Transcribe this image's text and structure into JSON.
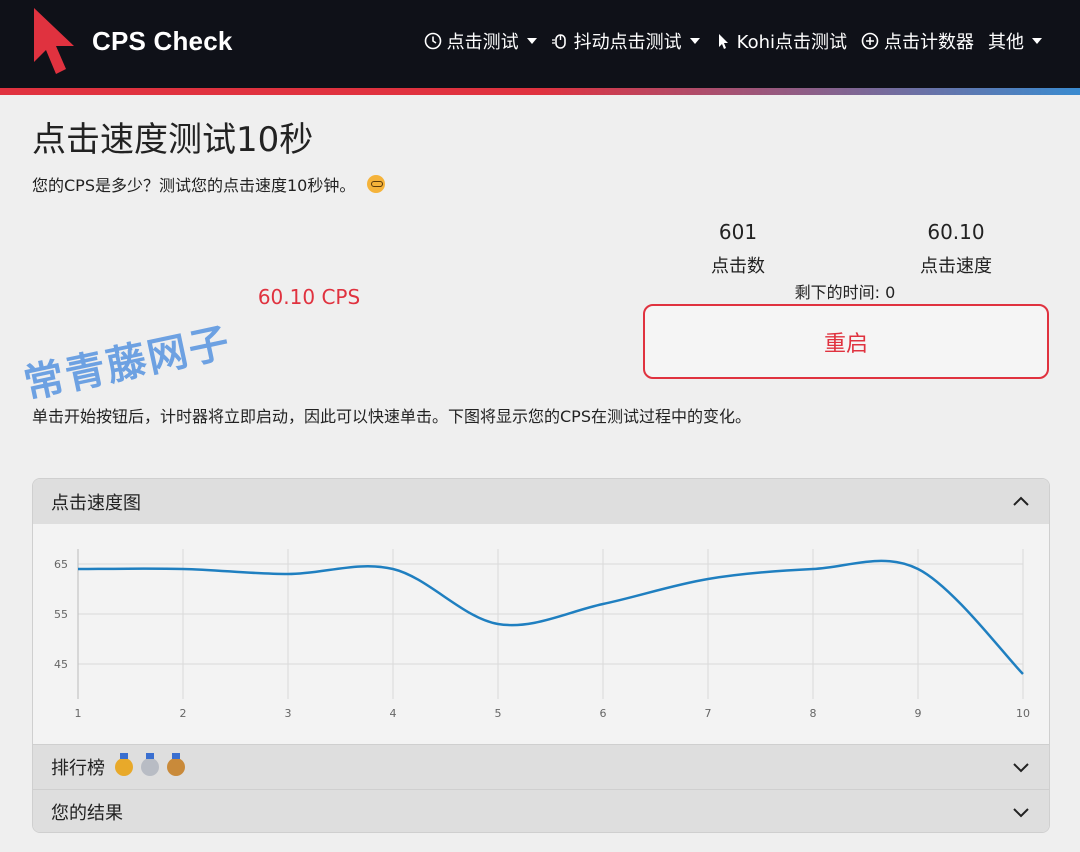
{
  "brand": {
    "name": "CPS Check"
  },
  "nav": {
    "items": [
      {
        "label": "点击测试",
        "icon": "clock-icon",
        "has_dropdown": true
      },
      {
        "label": "抖动点击测试",
        "icon": "mouse-icon",
        "has_dropdown": true
      },
      {
        "label": "Kohi点击测试",
        "icon": "cursor-icon",
        "has_dropdown": false
      },
      {
        "label": "点击计数器",
        "icon": "plus-circle-icon",
        "has_dropdown": false
      },
      {
        "label": "其他",
        "icon": "",
        "has_dropdown": true
      }
    ]
  },
  "page": {
    "title": "点击速度测试10秒",
    "subtitle": "您的CPS是多少？测试您的点击速度10秒钟。"
  },
  "test": {
    "cps_display": "60.10 CPS",
    "clicks_value": "601",
    "clicks_label": "点击数",
    "speed_value": "60.10",
    "speed_label": "点击速度",
    "remaining": "剩下的时间: 0",
    "restart_label": "重启"
  },
  "instruction": "单击开始按钮后，计时器将立即启动，因此可以快速单击。下图将显示您的CPS在测试过程中的变化。",
  "watermark": "常青藤网子",
  "accordion": {
    "chart_title": "点击速度图",
    "ranking_title": "排行榜",
    "results_title": "您的结果"
  },
  "colors": {
    "accent": "#e0323f",
    "line": "#1f7fc0",
    "navbar": "#0f1118"
  },
  "chart_data": {
    "type": "line",
    "x": [
      1,
      2,
      3,
      4,
      5,
      6,
      7,
      8,
      9,
      10
    ],
    "series": [
      {
        "values": [
          64,
          64,
          63,
          64,
          53,
          57,
          62,
          64,
          64,
          43
        ]
      }
    ],
    "xlabel": "",
    "ylabel": "",
    "yticks": [
      45,
      55,
      65
    ],
    "xlim": [
      1,
      10
    ],
    "ylim": [
      38,
      68
    ],
    "grid": true
  }
}
